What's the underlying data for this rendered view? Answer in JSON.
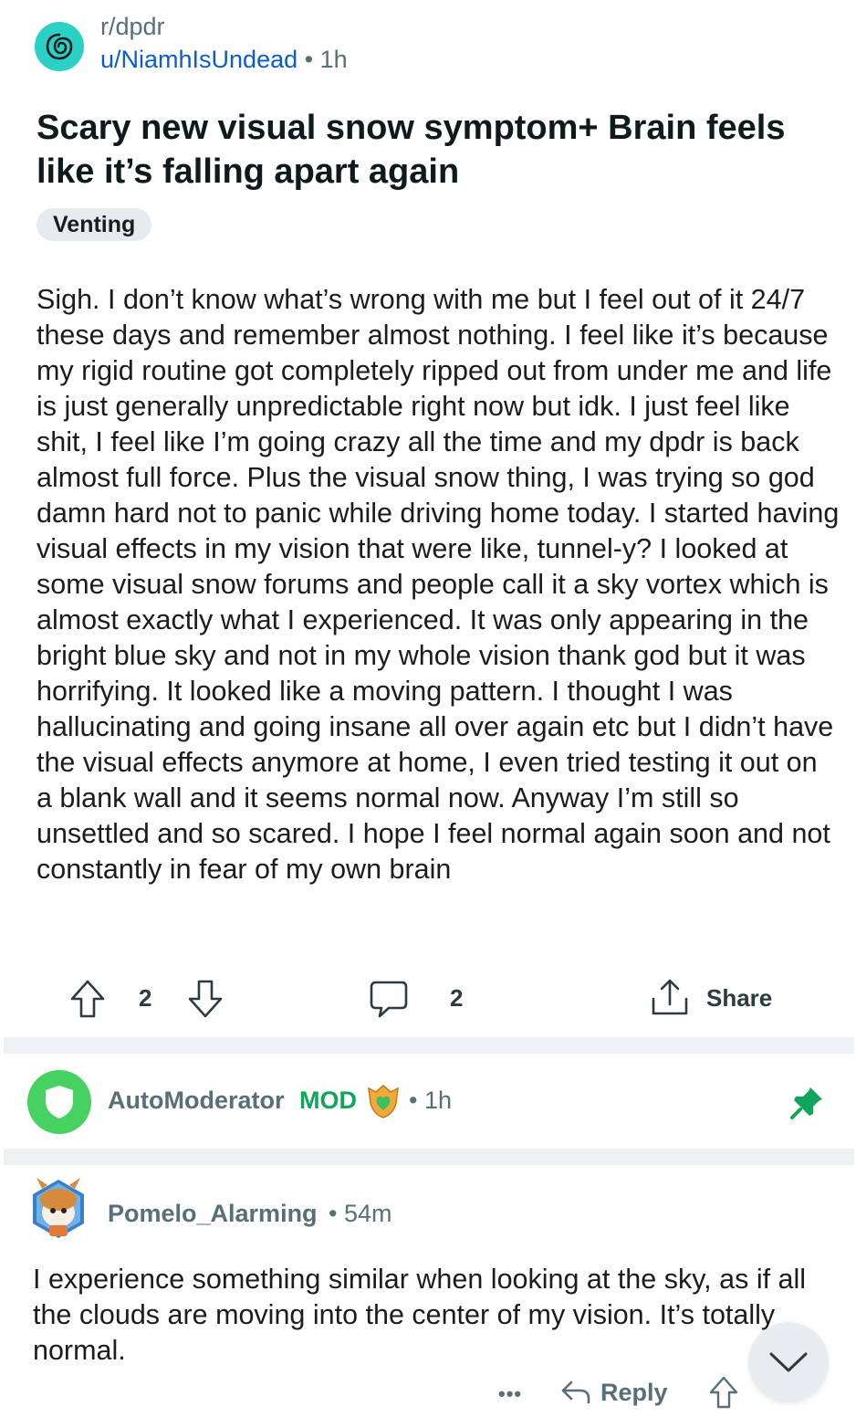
{
  "post": {
    "subreddit": "r/dpdr",
    "author": "u/NiamhIsUndead",
    "separator": "•",
    "time": "1h",
    "title": "Scary new visual snow symptom+ Brain feels like it’s falling apart again",
    "flair": "Venting",
    "body": "Sigh. I don’t know what’s wrong with me but I feel out of it 24/7 these days and remember almost nothing. I feel like it’s because my rigid routine got completely ripped out from under me and life is just generally unpredictable right now but idk. I just feel like shit, I feel like I’m going crazy all the time and my dpdr is back almost full force. Plus the visual snow thing, I was trying so god damn hard not to panic while driving home today. I started having visual effects in my vision that were like, tunnel-y? I looked at some visual snow forums and people call it a sky vortex which is almost exactly what I experienced. It was only appearing in the bright blue sky and not in my whole vision thank god but it was horrifying. It looked like a moving pattern. I thought I was hallucinating and going insane all over again etc but I didn’t have the visual effects anymore at home, I even tried testing it out on a blank wall and it seems normal now. Anyway I’m still so unsettled and so scared. I hope I feel normal again soon and not constantly in fear of my own brain",
    "vote_count": "2",
    "comment_count": "2",
    "share_label": "Share"
  },
  "automod": {
    "name": "AutoModerator",
    "tag": "MOD",
    "separator": "•",
    "time": "1h"
  },
  "comment": {
    "author": "Pomelo_Alarming",
    "separator": "•",
    "time": "54m",
    "body": "I experience something similar when looking at the sky, as if all the clouds are moving into the center of my vision. It’s totally normal.",
    "more_label": "•••",
    "reply_label": "Reply"
  },
  "colors": {
    "subreddit_icon": "#2ad1c4",
    "user_link": "#0a5cd4",
    "mod_green": "#0fa55a",
    "automod_avatar": "#46d160"
  }
}
